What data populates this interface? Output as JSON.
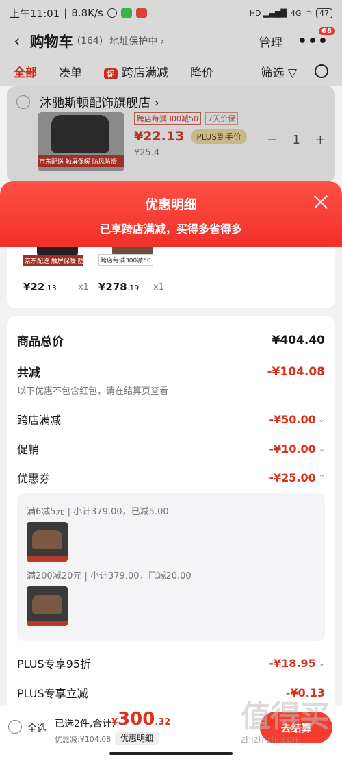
{
  "status": {
    "time": "上午11:01",
    "speed": "8.8K/s",
    "battery": "47",
    "network": "4G"
  },
  "header": {
    "back_glyph": "‹",
    "title": "购物车",
    "count": "(164)",
    "address_protect": "地址保护中 ›",
    "manage": "管理",
    "more_glyph": "•••",
    "badge": "68"
  },
  "tabs": {
    "all": "全部",
    "bundle": "凑单",
    "promo_chip": "促",
    "cross_store": "跨店满减",
    "price_drop": "降价",
    "filter": "筛选"
  },
  "store": {
    "name": "沐驰斯顿配饰旗舰店 ›",
    "thumb_tags": "京东配送 触屏保暖 防风防滑",
    "promo_tag": "跨店每满300减50",
    "price_tag": "7天价保",
    "price": "¥22.13",
    "plus_chip": "PLUS到手价",
    "original": "¥25.4",
    "qty": "1",
    "minus": "−",
    "plus": "+"
  },
  "sheet": {
    "title": "优惠明细",
    "subtitle": "已享跨店满减，买得多省得多",
    "items": [
      {
        "tagline": "京东配送 触屏保暖 防风防滑",
        "price_main": "¥22",
        "price_dec": ".13",
        "qty": "x1"
      },
      {
        "tagline": "跨店每满300减50",
        "price_main": "¥278",
        "price_dec": ".19",
        "qty": "x1"
      }
    ],
    "total_label": "商品总价",
    "total_value": "¥404.40",
    "reduce_label": "共减",
    "reduce_value": "-¥104.08",
    "note": "以下优惠不包含红包，请在结算页查看",
    "cross_label": "跨店满减",
    "cross_value": "-¥50.00",
    "promo_label": "促销",
    "promo_value": "-¥10.00",
    "coupon_label": "优惠券",
    "coupon_value": "-¥25.00",
    "coupon1": "满6减5元 | 小计379.00，已减5.00",
    "coupon2": "满200减20元 | 小计379.00，已减20.00",
    "plus95_label": "PLUS专享95折",
    "plus95_value": "-¥18.95",
    "plusdirect_label": "PLUS专享立减",
    "plusdirect_value": "-¥0.13"
  },
  "bottom": {
    "select_all": "全选",
    "selected": "已选2件,合计:",
    "total_symbol": "¥",
    "total_main": "300",
    "total_dec": ".32",
    "discount": "优惠减:¥104.08",
    "detail_chip": "优惠明细",
    "checkout": "去结算",
    "watermark": "值得买",
    "watermark_url": "zhizhizhi.com"
  }
}
